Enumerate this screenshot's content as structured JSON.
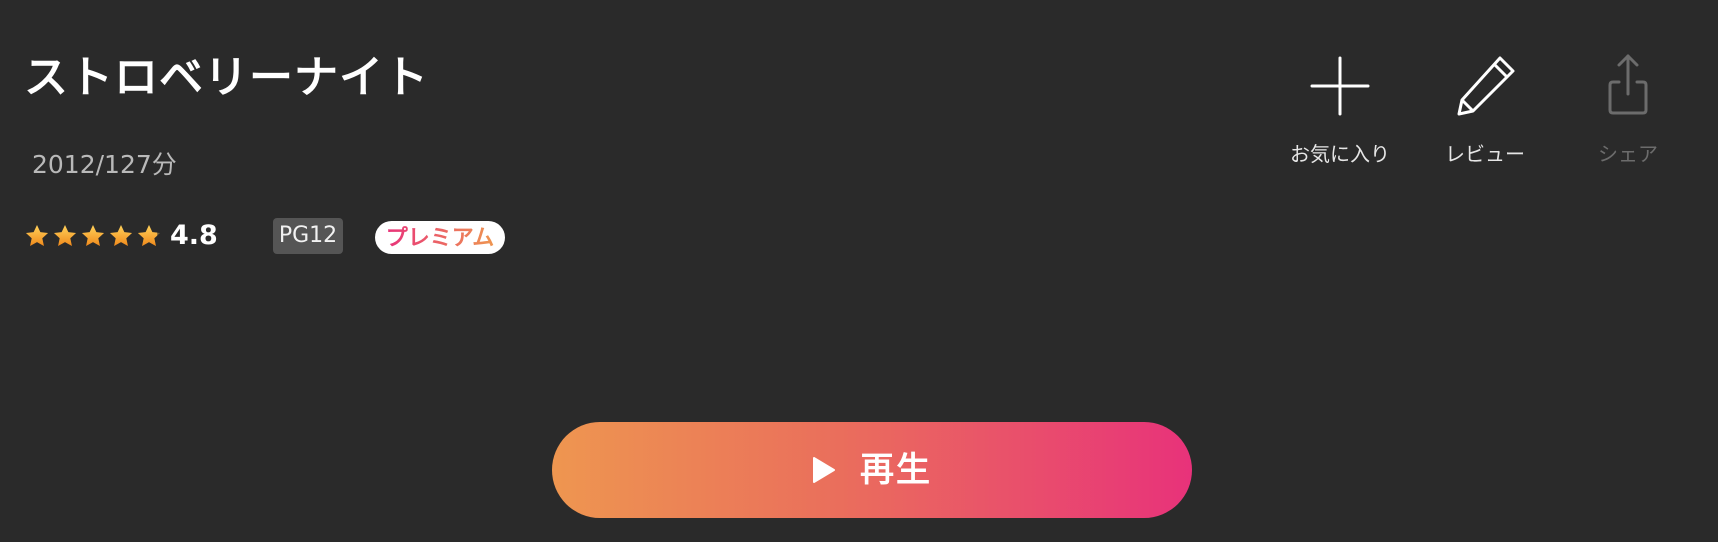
{
  "movie": {
    "title": "ストロベリーナイト",
    "meta": "2012/127分",
    "rating": {
      "value": "4.8",
      "stars_filled": 4.8,
      "stars_total": 5
    },
    "age_rating": "PG12",
    "premium_label": "プレミアム"
  },
  "actions": {
    "favorite": {
      "label": "お気に入り",
      "icon": "plus-icon"
    },
    "review": {
      "label": "レビュー",
      "icon": "pencil-icon"
    },
    "share": {
      "label": "シェア",
      "icon": "share-icon",
      "enabled": false
    }
  },
  "play": {
    "label": "再生",
    "icon": "play-icon"
  },
  "colors": {
    "background": "#2a2a2a",
    "star": "#f6a623",
    "gradient_start": "#ee9650",
    "gradient_end": "#e8327a",
    "pg_badge": "#555555",
    "disabled": "#6c6c6c"
  }
}
